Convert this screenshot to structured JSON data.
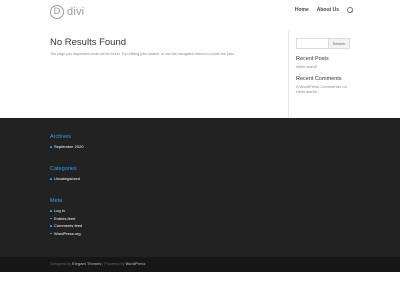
{
  "header": {
    "logo_letter": "D",
    "logo_text": "divi",
    "nav": [
      "Home",
      "About Us"
    ]
  },
  "main": {
    "title": "No Results Found",
    "message": "The page you requested could not be found. Try refining your search, or use the navigation above to locate the post."
  },
  "sidebar": {
    "search_placeholder": "",
    "search_button": "Search",
    "recent_posts_title": "Recent Posts",
    "recent_posts": [
      "Hello world!"
    ],
    "recent_comments_title": "Recent Comments",
    "recent_comment_line1": "A WordPress Commenter on",
    "recent_comment_line2": "Hello world!"
  },
  "footer": {
    "archives_title": "Archives",
    "archives": [
      "September 2020"
    ],
    "categories_title": "Categories",
    "categories": [
      "Uncategorized"
    ],
    "meta_title": "Meta",
    "meta": [
      "Log in",
      "Entries feed",
      "Comments feed",
      "WordPress.org"
    ]
  },
  "bottom": {
    "designed_by": "Designed by",
    "elegant": "Elegant Themes",
    "sep": "| Powered by",
    "wordpress": "WordPress"
  },
  "colors": {
    "accent": "#2ea3f2",
    "footer_bg": "#222222",
    "bottom_bg": "#171717"
  }
}
